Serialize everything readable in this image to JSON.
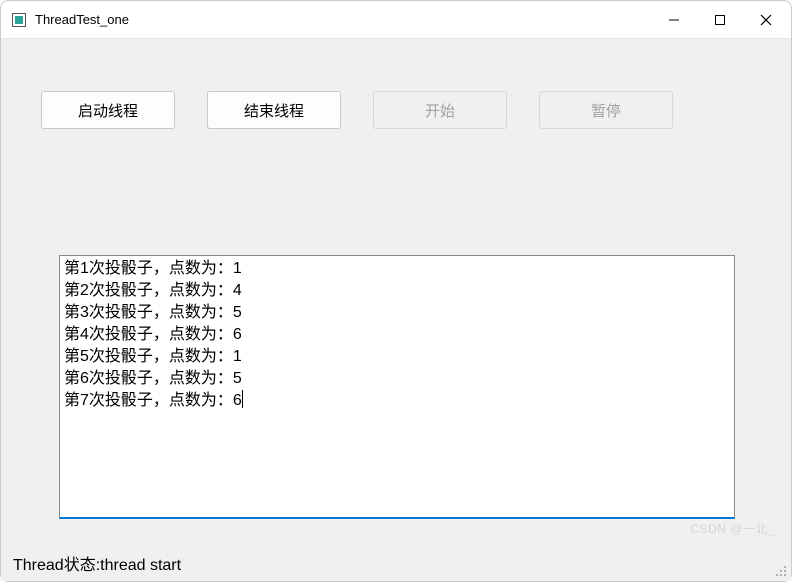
{
  "window": {
    "title": "ThreadTest_one"
  },
  "buttons": {
    "start_thread": "启动线程",
    "end_thread": "结束线程",
    "begin": "开始",
    "pause": "暂停"
  },
  "log_lines": [
    "第1次投骰子，点数为：1",
    "第2次投骰子，点数为：4",
    "第3次投骰子，点数为：5",
    "第4次投骰子，点数为：6",
    "第5次投骰子，点数为：1",
    "第6次投骰子，点数为：5",
    "第7次投骰子，点数为：6"
  ],
  "status": {
    "text": "Thread状态:thread start"
  },
  "watermark": "CSDN @一北_"
}
